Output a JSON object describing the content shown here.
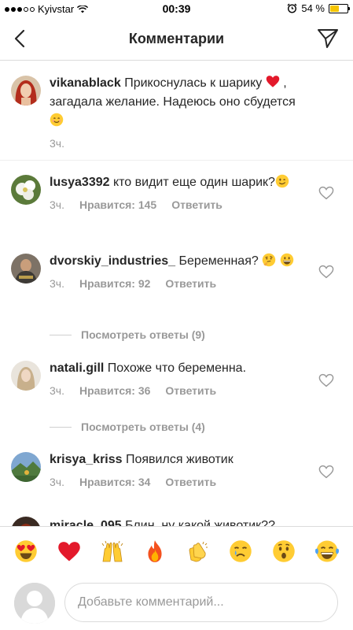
{
  "status_bar": {
    "carrier": "Kyivstar",
    "time": "00:39",
    "battery_percent": "54 %",
    "battery_level": 0.54,
    "signal_dots_filled": 3,
    "signal_dots_total": 5
  },
  "header": {
    "title": "Комментарии"
  },
  "comments": [
    {
      "username": "vikanablack",
      "text_before_emoji": "Прикоснулась к шарику",
      "text_after_emoji": ", загадала желание. Надеюсь оно сбудется",
      "time": "3ч."
    },
    {
      "username": "lusya3392",
      "text": "кто видит еще один шарик?",
      "time": "3ч.",
      "likes": "Нравится: 145",
      "reply": "Ответить"
    },
    {
      "username": "dvorskiy_industries_",
      "text": "Беременная?",
      "time": "3ч.",
      "likes": "Нравится: 92",
      "reply": "Ответить",
      "view_replies": "Посмотреть ответы (9)"
    },
    {
      "username": "natali.gill",
      "text": "Похоже что беременна.",
      "time": "3ч.",
      "likes": "Нравится: 36",
      "reply": "Ответить",
      "view_replies": "Посмотреть ответы (4)"
    },
    {
      "username": "krisya_kriss",
      "text": "Появился животик",
      "time": "3ч.",
      "likes": "Нравится: 34",
      "reply": "Ответить"
    },
    {
      "username": "miracle_095",
      "text": "Блин, ну какой животик??"
    }
  ],
  "emoji_bar": [
    "heart-eyes-emoji",
    "red-heart-emoji",
    "raised-hands-emoji",
    "fire-emoji",
    "clapping-hands-emoji",
    "crying-face-emoji",
    "astonished-face-emoji",
    "tears-of-joy-emoji"
  ],
  "composer": {
    "placeholder": "Добавьте комментарий..."
  },
  "colors": {
    "text": "#262626",
    "secondary": "#999999",
    "divider": "#dbdbdb",
    "heart_red": "#ed4956",
    "emoji_yellow": "#ffcc33",
    "battery_yellow": "#f5c400"
  }
}
